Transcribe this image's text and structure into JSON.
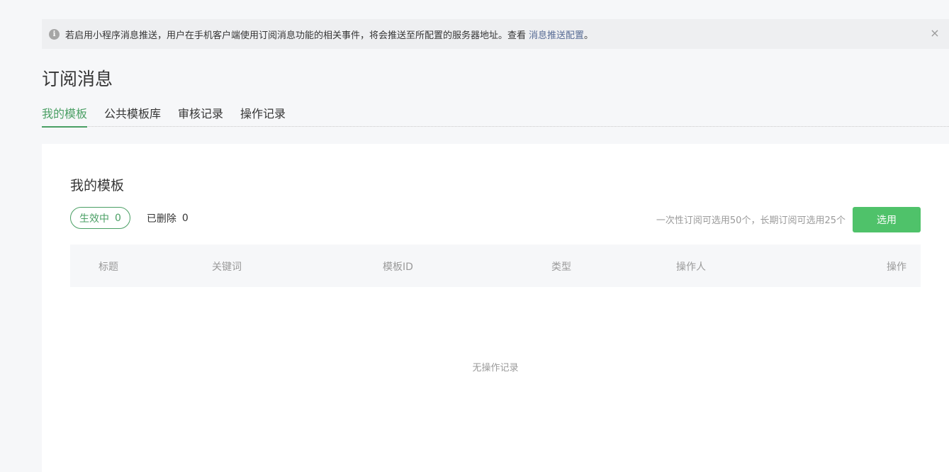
{
  "notice": {
    "icon": "info-icon",
    "text": "若启用小程序消息推送，用户在手机客户端使用订阅消息功能的相关事件，将会推送至所配置的服务器地址。查看",
    "link": "消息推送配置",
    "suffix": "。",
    "close": "×"
  },
  "page_title": "订阅消息",
  "tabs": [
    {
      "label": "我的模板",
      "active": true
    },
    {
      "label": "公共模板库",
      "active": false
    },
    {
      "label": "审核记录",
      "active": false
    },
    {
      "label": "操作记录",
      "active": false
    }
  ],
  "card": {
    "title": "我的模板",
    "filters": {
      "active": {
        "label": "生效中",
        "count": "0"
      },
      "deleted": {
        "label": "已删除",
        "count": "0"
      }
    },
    "quota_hint": "一次性订阅可选用50个，长期订阅可选用25个",
    "select_button": "选用",
    "columns": [
      "标题",
      "关键词",
      "模板ID",
      "类型",
      "操作人",
      "操作"
    ],
    "empty_text": "无操作记录"
  },
  "colors": {
    "accent": "#4a9f64",
    "button": "#4fc26a",
    "link": "#576b95"
  }
}
